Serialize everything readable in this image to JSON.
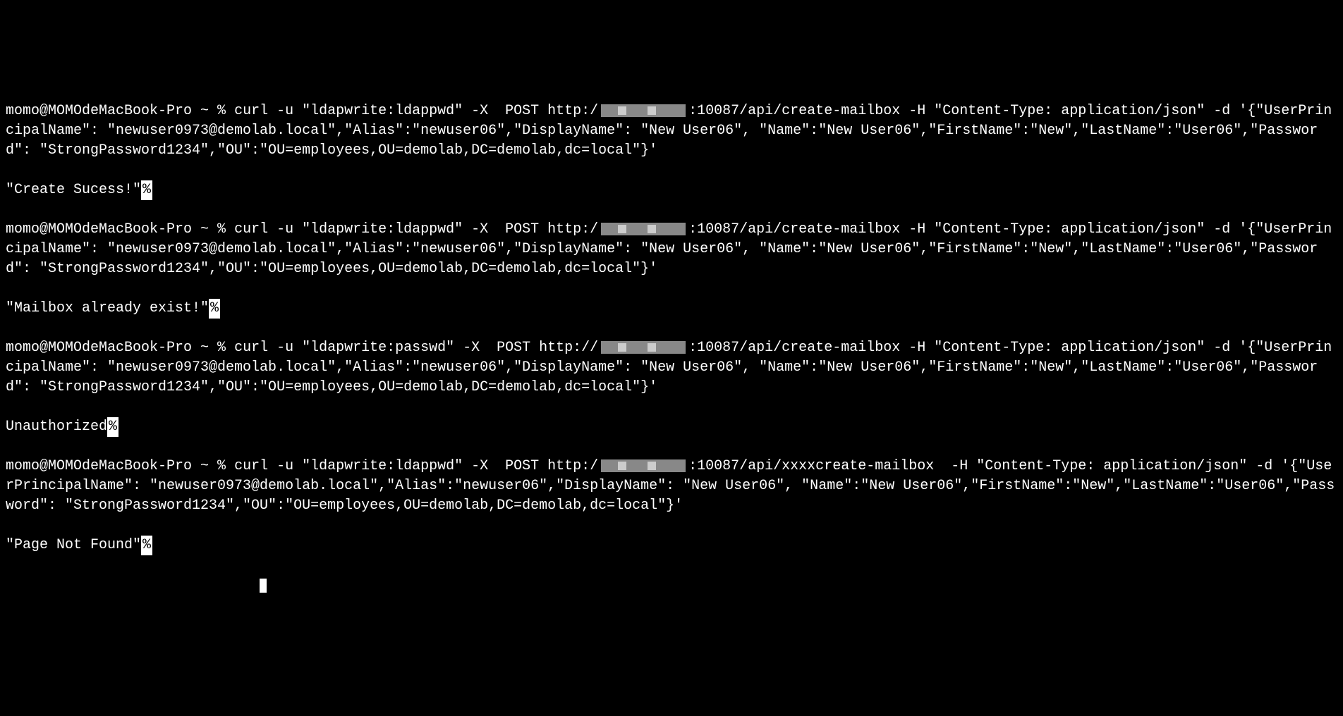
{
  "terminal": {
    "prompt": "momo@MOMOdeMacBook-Pro ~ % ",
    "commands": [
      {
        "cmd_before_redact": "curl -u \"ldapwrite:ldappwd\" -X  POST http:/",
        "cmd_after_redact": ":10087/api/create-mailbox -H \"Content-Type: application/json\" -d '{\"UserPrincipalName\": \"newuser0973@demolab.local\",\"Alias\":\"newuser06\",\"DisplayName\": \"New User06\", \"Name\":\"New User06\",\"FirstName\":\"New\",\"LastName\":\"User06\",\"Password\": \"StrongPassword1234\",\"OU\":\"OU=employees,OU=demolab,DC=demolab,dc=local\"}'",
        "response": "\"Create Sucess!\""
      },
      {
        "cmd_before_redact": "curl -u \"ldapwrite:ldappwd\" -X  POST http:/",
        "cmd_after_redact": ":10087/api/create-mailbox -H \"Content-Type: application/json\" -d '{\"UserPrincipalName\": \"newuser0973@demolab.local\",\"Alias\":\"newuser06\",\"DisplayName\": \"New User06\", \"Name\":\"New User06\",\"FirstName\":\"New\",\"LastName\":\"User06\",\"Password\": \"StrongPassword1234\",\"OU\":\"OU=employees,OU=demolab,DC=demolab,dc=local\"}'",
        "response": "\"Mailbox already exist!\""
      },
      {
        "cmd_before_redact": "curl -u \"ldapwrite:passwd\" -X  POST http://",
        "cmd_after_redact": ":10087/api/create-mailbox -H \"Content-Type: application/json\" -d '{\"UserPrincipalName\": \"newuser0973@demolab.local\",\"Alias\":\"newuser06\",\"DisplayName\": \"New User06\", \"Name\":\"New User06\",\"FirstName\":\"New\",\"LastName\":\"User06\",\"Password\": \"StrongPassword1234\",\"OU\":\"OU=employees,OU=demolab,DC=demolab,dc=local\"}'",
        "response": "Unauthorized"
      },
      {
        "cmd_before_redact": "curl -u \"ldapwrite:ldappwd\" -X  POST http:/",
        "cmd_after_redact": ":10087/api/xxxxcreate-mailbox  -H \"Content-Type: application/json\" -d '{\"UserPrincipalName\": \"newuser0973@demolab.local\",\"Alias\":\"newuser06\",\"DisplayName\": \"New User06\", \"Name\":\"New User06\",\"FirstName\":\"New\",\"LastName\":\"User06\",\"Password\": \"StrongPassword1234\",\"OU\":\"OU=employees,OU=demolab,DC=demolab,dc=local\"}'",
        "response": "\"Page Not Found\""
      }
    ],
    "percent_char": "%"
  }
}
